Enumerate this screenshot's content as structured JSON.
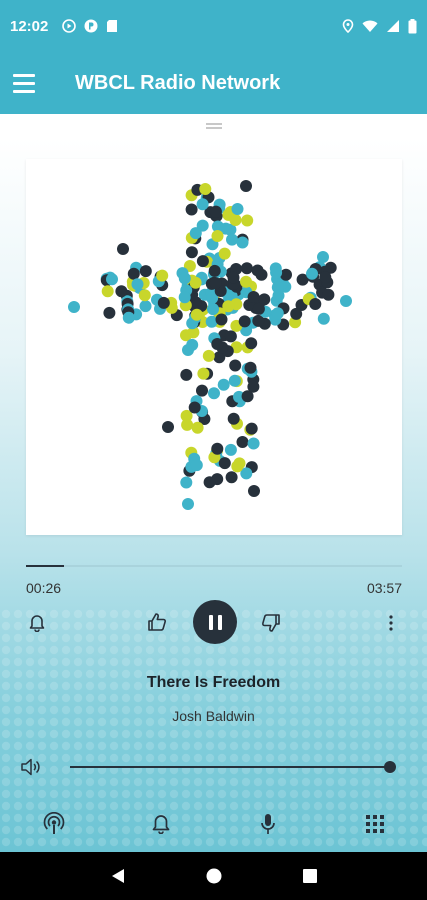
{
  "status_bar": {
    "time": "12:02",
    "icons_left": [
      "play-circle-icon",
      "podcast-app-icon",
      "sd-card-icon"
    ],
    "icons_right": [
      "location-icon",
      "wifi-icon",
      "signal-icon",
      "battery-icon"
    ]
  },
  "app_bar": {
    "title": "WBCL Radio Network",
    "menu_icon": "hamburger-menu-icon"
  },
  "colors": {
    "primary": "#3fb3c9",
    "dark": "#27313b",
    "lime": "#c8d62b",
    "teal": "#3fb3c9"
  },
  "player": {
    "progress": 0.1,
    "elapsed": "00:26",
    "duration": "03:57",
    "song_title": "There Is Freedom",
    "artist": "Josh Baldwin",
    "volume": 1.0,
    "controls": [
      "alarm-bell-icon",
      "thumbs-up-icon",
      "pause-icon",
      "thumbs-down-icon",
      "more-vert-icon"
    ]
  },
  "bottom_tabs": [
    "podcast-icon",
    "notification-bell-icon",
    "microphone-icon",
    "grid-icon"
  ],
  "nav_bar": [
    "back-icon",
    "home-icon",
    "recents-icon"
  ]
}
